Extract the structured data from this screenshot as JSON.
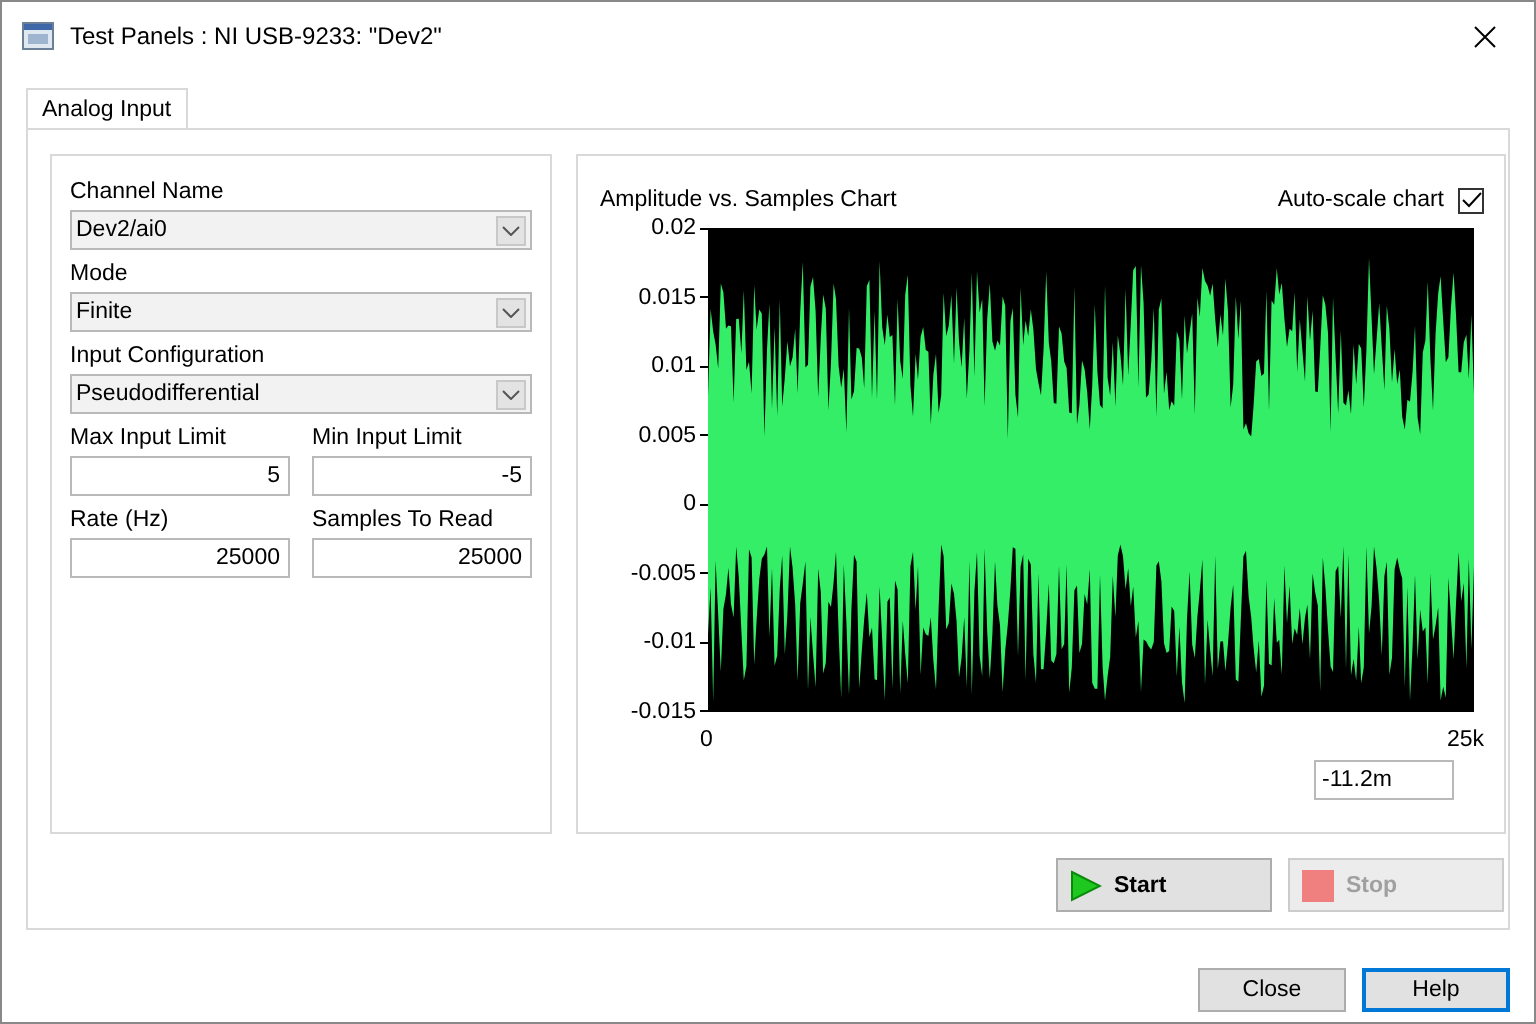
{
  "window": {
    "title": "Test Panels : NI USB-9233: \"Dev2\""
  },
  "tabs": [
    {
      "label": "Analog Input",
      "selected": true
    }
  ],
  "settings": {
    "channel_name": {
      "label": "Channel Name",
      "value": "Dev2/ai0"
    },
    "mode": {
      "label": "Mode",
      "value": "Finite"
    },
    "input_configuration": {
      "label": "Input Configuration",
      "value": "Pseudodifferential"
    },
    "max_input_limit": {
      "label": "Max Input Limit",
      "value": "5"
    },
    "min_input_limit": {
      "label": "Min Input Limit",
      "value": "-5"
    },
    "rate": {
      "label": "Rate (Hz)",
      "value": "25000"
    },
    "samples_to_read": {
      "label": "Samples To Read",
      "value": "25000"
    }
  },
  "chart": {
    "title": "Amplitude vs. Samples Chart",
    "autoscale": {
      "label": "Auto-scale chart",
      "checked": true
    },
    "y_ticks": [
      "0.02",
      "0.015",
      "0.01",
      "0.005",
      "0",
      "-0.005",
      "-0.01",
      "-0.015"
    ],
    "x_ticks": [
      "0",
      "25k"
    ],
    "readout": "-11.2m"
  },
  "actions": [
    {
      "label": "Start",
      "kind": "start",
      "disabled": false
    },
    {
      "label": "Stop",
      "kind": "stop",
      "disabled": true
    }
  ],
  "buttons": [
    {
      "label": "Close",
      "focused": false
    },
    {
      "label": "Help",
      "focused": true
    }
  ]
}
